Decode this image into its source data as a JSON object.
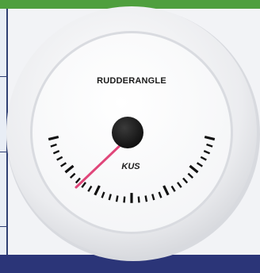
{
  "gauge": {
    "title": "RUDDERANGLE",
    "brand": "KUS",
    "needle_color": "#e0467a",
    "bezel_color": "#e6e7ea",
    "dial_color": "#ffffff",
    "hub_color": "#141414"
  },
  "scene": {
    "top_bar_color": "#4f9f3e",
    "bottom_bar_color": "#2b3578",
    "background_color": "#f2f3f6"
  }
}
